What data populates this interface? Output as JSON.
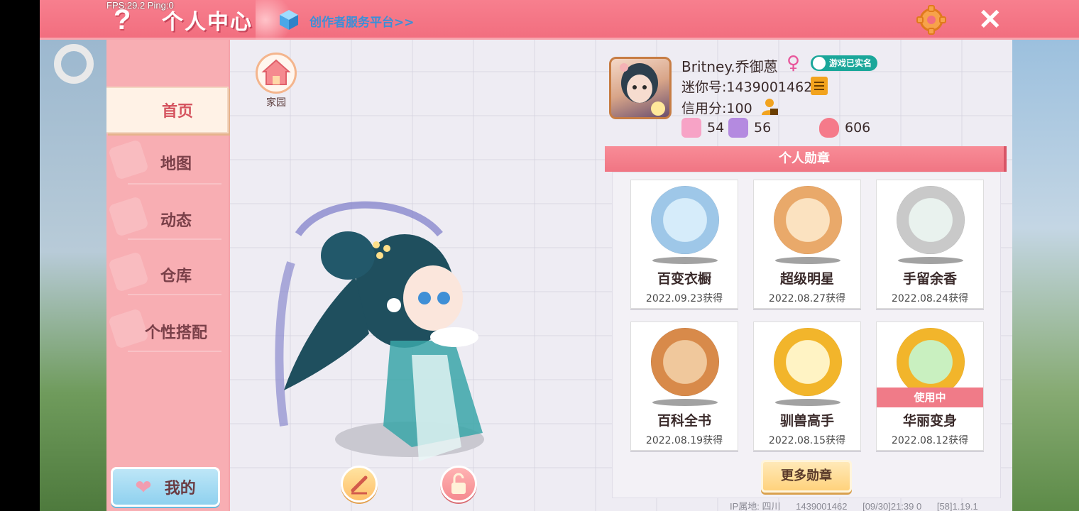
{
  "status": {
    "fps": "FPS:29.2  Ping:0"
  },
  "header": {
    "help_icon": "question-mark-icon",
    "title": "个人中心",
    "creator_link": "创作者服务平台>>",
    "settings_icon": "gear-icon",
    "close_icon": "close-icon"
  },
  "sidebar": {
    "items": [
      {
        "label": "首页",
        "active": true
      },
      {
        "label": "地图",
        "active": false
      },
      {
        "label": "动态",
        "active": false
      },
      {
        "label": "仓库",
        "active": false
      },
      {
        "label": "个性搭配",
        "active": false
      }
    ],
    "mine_label": "我的"
  },
  "home": {
    "label": "家园"
  },
  "profile": {
    "username": "Britney.乔御蒽",
    "gender_icon": "female-icon",
    "verified": "游戏已实名",
    "mini_id": "迷你号:1439001462",
    "credit": "信用分:100",
    "stats": [
      {
        "icon": "flower-icon",
        "value": "54"
      },
      {
        "icon": "trophy-person-icon",
        "value": "56"
      },
      {
        "icon": "flame-icon",
        "value": "606"
      }
    ]
  },
  "badges": {
    "title": "个人勋章",
    "items": [
      {
        "name": "百变衣橱",
        "date": "2022.09.23获得",
        "medal_color": "#9ec7e8"
      },
      {
        "name": "超级明星",
        "date": "2022.08.27获得",
        "medal_color": "#e9a96a"
      },
      {
        "name": "手留余香",
        "date": "2022.08.24获得",
        "medal_color": "#c9c9c9"
      },
      {
        "name": "百科全书",
        "date": "2022.08.19获得",
        "medal_color": "#d88a4a"
      },
      {
        "name": "驯兽高手",
        "date": "2022.08.15获得",
        "medal_color": "#f2b52b"
      },
      {
        "name": "华丽变身",
        "date": "2022.08.12获得",
        "medal_color": "#f2b52b",
        "in_use": "使用中"
      }
    ],
    "more_label": "更多勋章"
  },
  "footer": {
    "ip": "IP属地: 四川",
    "id": "1439001462",
    "time": "[09/30]21:39 0",
    "version": "[58]1.19.1"
  }
}
